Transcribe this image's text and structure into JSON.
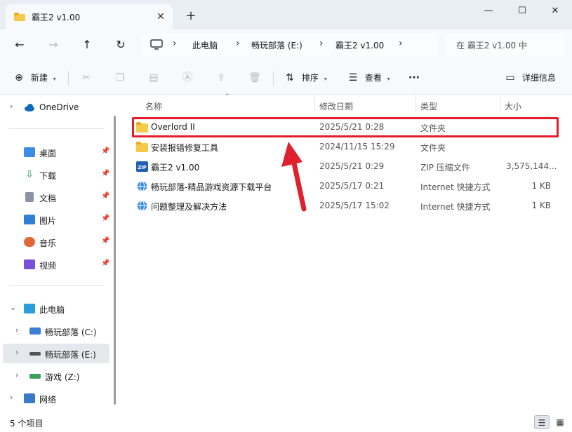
{
  "window": {
    "tab_title": "霸王2 v1.00",
    "close_tab_glyph": "✕",
    "new_tab_glyph": "+",
    "minimize_glyph": "—",
    "maximize_glyph": "☐",
    "close_glyph": "✕"
  },
  "nav": {
    "back_glyph": "←",
    "forward_glyph": "→",
    "up_glyph": "↑",
    "refresh_glyph": "↻",
    "breadcrumbs": [
      "此电脑",
      "畅玩部落 (E:)",
      "霸王2 v1.00"
    ],
    "chevron": "›",
    "search_placeholder": "在 霸王2 v1.00 中"
  },
  "commands": {
    "new_label": "新建",
    "sort_label": "排序",
    "view_label": "查看",
    "more_glyph": "···",
    "details_label": "详细信息"
  },
  "sidebar": {
    "onedrive": "OneDrive",
    "quick_access": [
      {
        "label": "桌面",
        "color": "#3a8ee6"
      },
      {
        "label": "下载",
        "color": "#2f9d5a"
      },
      {
        "label": "文档",
        "color": "#8a93a6"
      },
      {
        "label": "图片",
        "color": "#2f7fd8"
      },
      {
        "label": "音乐",
        "color": "#e2683a"
      },
      {
        "label": "视频",
        "color": "#7b4fd8"
      }
    ],
    "this_pc": "此电脑",
    "drives": [
      {
        "label": "畅玩部落 (C:)"
      },
      {
        "label": "畅玩部落 (E:)"
      },
      {
        "label": "游戏 (Z:)"
      }
    ],
    "network": "网络"
  },
  "columns": {
    "name": "名称",
    "date": "修改日期",
    "type": "类型",
    "size": "大小"
  },
  "files": [
    {
      "name": "Overlord II",
      "date": "2025/5/21 0:28",
      "type": "文件夹",
      "size": "",
      "icon": "folder-icon"
    },
    {
      "name": "安装报错修复工具",
      "date": "2024/11/15 15:29",
      "type": "文件夹",
      "size": "",
      "icon": "folder-icon"
    },
    {
      "name": "霸王2 v1.00",
      "date": "2025/5/21 0:29",
      "type": "ZIP 压缩文件",
      "size": "3,575,144...",
      "icon": "zip-icon"
    },
    {
      "name": "畅玩部落-精品游戏资源下载平台",
      "date": "2025/5/17 0:21",
      "type": "Internet 快捷方式",
      "size": "1 KB",
      "icon": "internet-shortcut-icon"
    },
    {
      "name": "问题整理及解决方法",
      "date": "2025/5/17 15:02",
      "type": "Internet 快捷方式",
      "size": "1 KB",
      "icon": "internet-shortcut-icon"
    }
  ],
  "status": {
    "item_count": "5 个项目"
  },
  "colors": {
    "accent": "#005fb8",
    "highlight_box": "#e51c2b",
    "arrow": "#e0202c"
  }
}
